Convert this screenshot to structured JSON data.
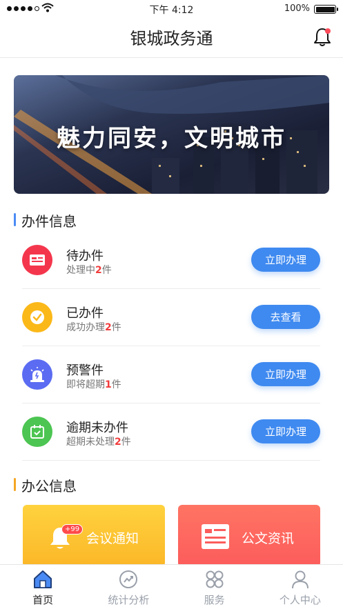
{
  "status_bar": {
    "time": "下午 4:12",
    "battery": "100%"
  },
  "header": {
    "title": "银城政务通"
  },
  "banner": {
    "slogan": "魅力同安，文明城市"
  },
  "sections": {
    "tasks_title": "办件信息",
    "office_title": "办公信息"
  },
  "tasks": [
    {
      "name": "待办件",
      "sub_prefix": "处理中",
      "count": "2",
      "sub_suffix": "件",
      "button": "立即办理",
      "icon": "id-card-icon",
      "color": "#f4364c"
    },
    {
      "name": "已办件",
      "sub_prefix": "成功办理",
      "count": "2",
      "sub_suffix": "件",
      "button": "去查看",
      "icon": "check-circle-icon",
      "color": "#fbb819"
    },
    {
      "name": "预警件",
      "sub_prefix": "即将超期",
      "count": "1",
      "sub_suffix": "件",
      "button": "立即办理",
      "icon": "alarm-light-icon",
      "color": "#5b6cf2"
    },
    {
      "name": "逾期未办件",
      "sub_prefix": "超期未处理",
      "count": "2",
      "sub_suffix": "件",
      "button": "立即办理",
      "icon": "calendar-check-icon",
      "color": "#4cc552"
    }
  ],
  "office": {
    "meeting_label": "会议通知",
    "meeting_badge": "+99",
    "docs_label": "公文资讯"
  },
  "tabbar": [
    {
      "label": "首页",
      "icon": "home-icon",
      "active": true
    },
    {
      "label": "统计分析",
      "icon": "chart-icon",
      "active": false
    },
    {
      "label": "服务",
      "icon": "grid-icon",
      "active": false
    },
    {
      "label": "个人中心",
      "icon": "person-icon",
      "active": false
    }
  ]
}
